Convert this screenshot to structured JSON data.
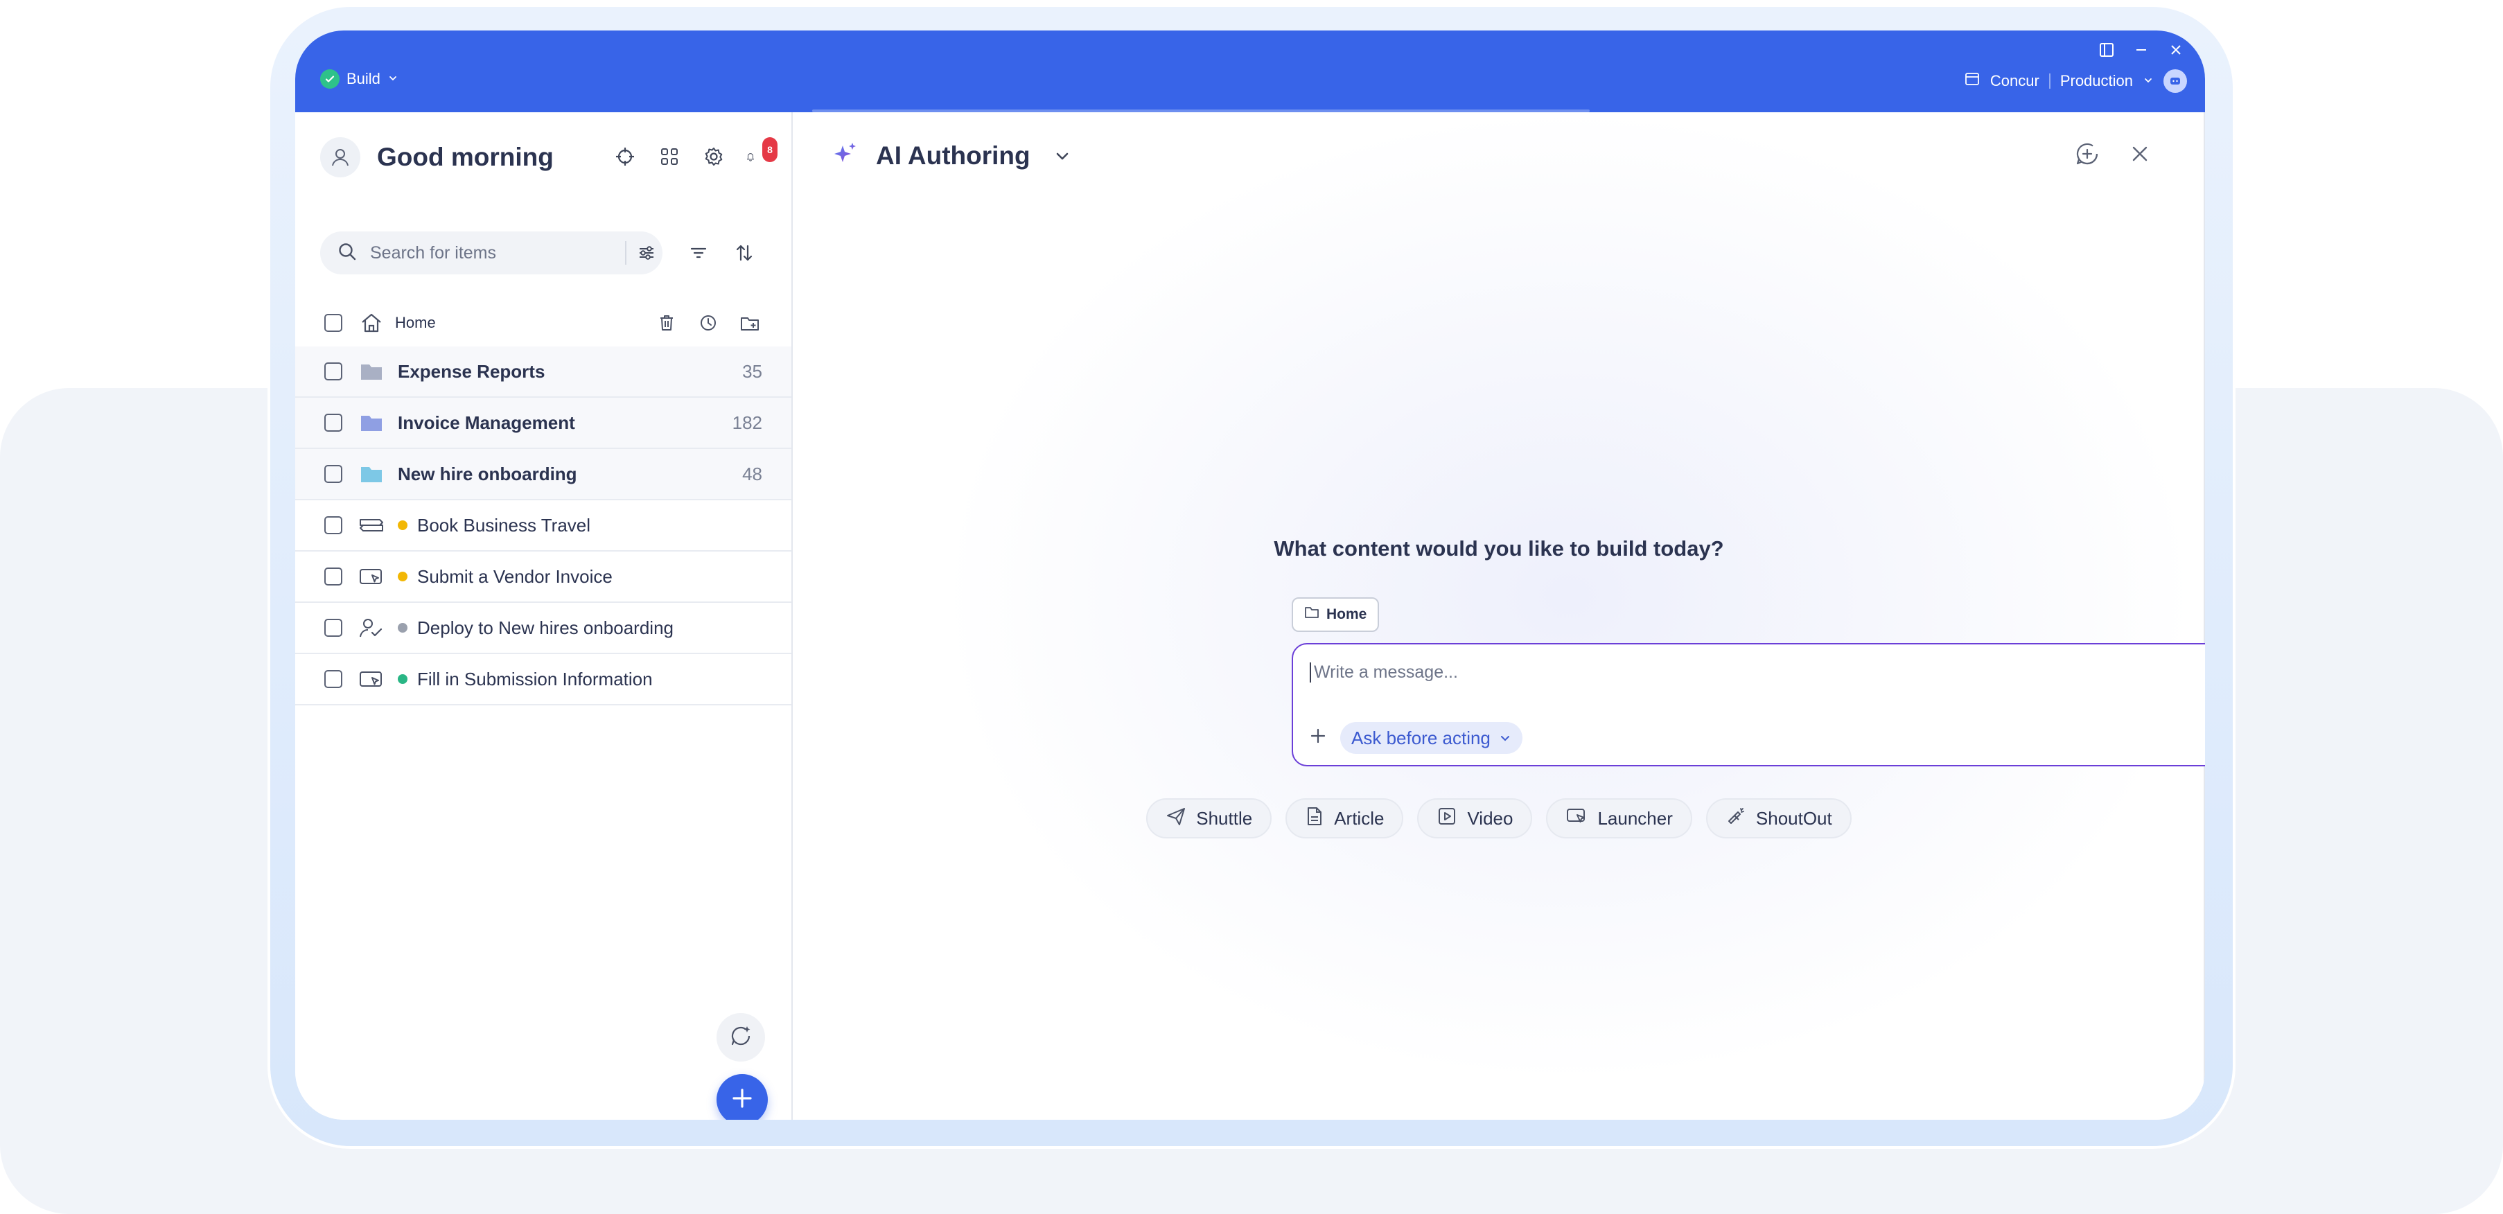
{
  "topbar": {
    "build_label": "Build",
    "system_label": "Concur",
    "environment_label": "Production"
  },
  "sidebar": {
    "greeting": "Good morning",
    "notification_count": "8",
    "search": {
      "placeholder": "Search for items",
      "value": ""
    },
    "home_label": "Home",
    "items": [
      {
        "type": "folder",
        "label": "Expense Reports",
        "count": "35",
        "icon": "folder-icon",
        "color": "#a9b0c4"
      },
      {
        "type": "folder",
        "label": "Invoice Management",
        "count": "182",
        "icon": "folder-icon",
        "color": "#8f9fe3"
      },
      {
        "type": "folder",
        "label": "New hire onboarding",
        "count": "48",
        "icon": "folder-icon",
        "color": "#7dc8e6"
      },
      {
        "type": "flow",
        "label": "Book Business Travel",
        "status": "draft",
        "status_color": "#f2b705",
        "icon": "smart-walkthru-icon"
      },
      {
        "type": "launcher",
        "label": "Submit a Vendor Invoice",
        "status": "draft",
        "status_color": "#f2b705",
        "icon": "launcher-icon"
      },
      {
        "type": "onboarding",
        "label": "Deploy to New hires onboarding",
        "status": "unpublished",
        "status_color": "#9aa0ad",
        "icon": "onboarding-task-icon"
      },
      {
        "type": "launcher",
        "label": "Fill in Submission Information",
        "status": "published",
        "status_color": "#29b685",
        "icon": "launcher-icon"
      }
    ]
  },
  "main": {
    "title": "AI Authoring",
    "prompt_heading": "What content would you like to build today?",
    "context_chip": "Home",
    "composer": {
      "placeholder": "Write a message...",
      "value": "",
      "mode": "Ask before acting"
    },
    "quick_actions": [
      {
        "label": "Shuttle",
        "icon": "paper-plane-icon"
      },
      {
        "label": "Article",
        "icon": "document-icon"
      },
      {
        "label": "Video",
        "icon": "video-icon"
      },
      {
        "label": "Launcher",
        "icon": "launcher-icon"
      },
      {
        "label": "ShoutOut",
        "icon": "megaphone-icon"
      }
    ]
  },
  "colors": {
    "brand_blue": "#3864e8",
    "accent_purple": "#6b3fd8",
    "badge_red": "#e53946",
    "success_green": "#2ec28a"
  }
}
